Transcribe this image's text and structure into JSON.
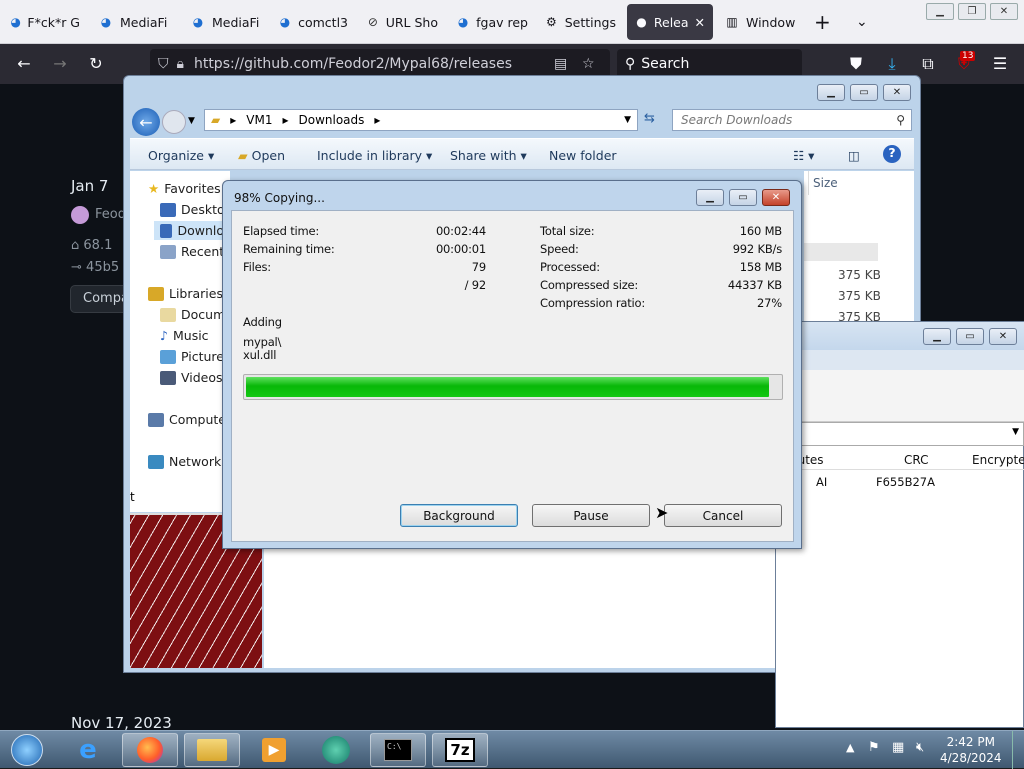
{
  "browser": {
    "tabs": [
      {
        "label": "F*ck*r G",
        "icon": "wave-icon"
      },
      {
        "label": "MediaFi",
        "icon": "wave-icon"
      },
      {
        "label": "MediaFi",
        "icon": "wave-icon"
      },
      {
        "label": "comctl3",
        "icon": "wave-icon"
      },
      {
        "label": "URL Sho",
        "icon": "link-icon"
      },
      {
        "label": "fgav rep",
        "icon": "wave-icon"
      },
      {
        "label": "Settings",
        "icon": "gear-icon"
      },
      {
        "label": "Relea",
        "icon": "github-icon",
        "active": true
      },
      {
        "label": "Window",
        "icon": "archive-icon"
      }
    ],
    "url": "https://github.com/Feodor2/Mypal68/releases",
    "search_placeholder": "Search",
    "badge_count": "13"
  },
  "page": {
    "date1": "Jan 7",
    "author": "Feod",
    "commit1": "68.1",
    "commit2": "45b5",
    "compare": "Compa",
    "date2": "Nov 17, 2023"
  },
  "explorer": {
    "breadcrumb": [
      "VM1",
      "Downloads"
    ],
    "search_placeholder": "Search Downloads",
    "commands": {
      "organize": "Organize",
      "open": "Open",
      "include": "Include in library",
      "share": "Share with",
      "newfolder": "New folder"
    },
    "nav": {
      "favorites": "Favorites",
      "desktop": "Desktop",
      "downloads": "Downlo",
      "recent": "Recent P",
      "libraries": "Libraries",
      "documents": "Docume",
      "music": "Music",
      "pictures": "Pictures",
      "videos": "Videos",
      "computer": "Compute",
      "network": "Network"
    },
    "size_header": "Size",
    "sizes": [
      "375 KB",
      "375 KB",
      "375 KB"
    ]
  },
  "archive_window": {
    "columns": [
      "butes",
      "CRC",
      "Encrypte"
    ],
    "row": {
      "attr": "AI",
      "crc": "F655B27A"
    }
  },
  "copy_dialog": {
    "title": "98% Copying...",
    "elapsed_label": "Elapsed time:",
    "elapsed": "00:02:44",
    "remaining_label": "Remaining time:",
    "remaining": "00:00:01",
    "files_label": "Files:",
    "files": "79",
    "files_total": "/ 92",
    "total_size_label": "Total size:",
    "total_size": "160 MB",
    "speed_label": "Speed:",
    "speed": "992 KB/s",
    "processed_label": "Processed:",
    "processed": "158 MB",
    "compressed_label": "Compressed size:",
    "compressed": "44337 KB",
    "ratio_label": "Compression ratio:",
    "ratio": "27%",
    "action": "Adding",
    "file_line1": "mypal\\",
    "file_line2": "xul.dll",
    "progress": 0.98,
    "buttons": {
      "background": "Background",
      "pause": "Pause",
      "cancel": "Cancel"
    }
  },
  "taskbar": {
    "time": "2:42 PM",
    "date": "4/28/2024"
  },
  "colors": {
    "progress_green": "#14c814",
    "taskbar": "#4a6580",
    "github_bg": "#0d1117"
  }
}
